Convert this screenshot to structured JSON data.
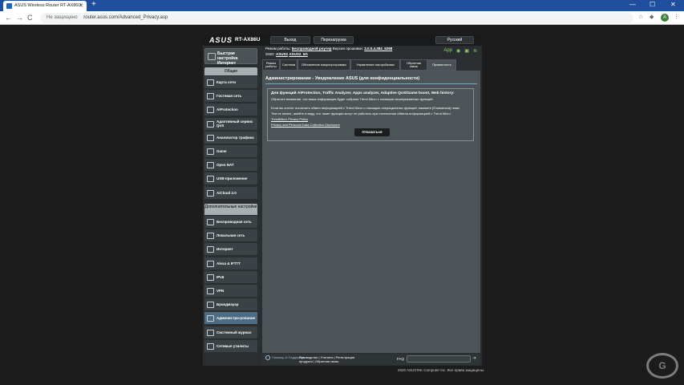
{
  "browser": {
    "tab_title": "ASUS Wireless Router RT-AX86U",
    "tab_close": "✕",
    "new_tab": "+",
    "win_min": "—",
    "win_max": "☐",
    "win_close": "✕",
    "back": "←",
    "forward": "→",
    "reload": "C",
    "security": "Не защищено",
    "url": "router.asus.com/Advanced_Privacy.asp",
    "avatar": "A"
  },
  "router": {
    "logo": "ASUS",
    "model": "RT-AX86U",
    "logout": "Выход",
    "reboot": "Перезагрузка",
    "language": "Русский",
    "status_line1_prefix": "Режим работы:",
    "op_mode": "Беспроводной роутер",
    "fw_prefix": "Версия прошивки:",
    "firmware": "3.0.0.4.384_5298",
    "ssid_prefix": "SSID:",
    "ssid1": "ASUS2",
    "ssid2": "ASUS2_5G",
    "app_label": "App"
  },
  "sidebar": {
    "quick_setup": "Быстрая настройка Интернет",
    "general": "Общие",
    "advanced": "Дополнительные настройки",
    "items_general": [
      {
        "label": "Карта сети",
        "icon": "network-map-icon"
      },
      {
        "label": "Гостевая сеть",
        "icon": "guest-network-icon"
      },
      {
        "label": "AiProtection",
        "icon": "shield-icon"
      },
      {
        "label": "Адаптивный сервис QoS",
        "icon": "qos-icon"
      },
      {
        "label": "Анализатор трафика",
        "icon": "traffic-icon"
      },
      {
        "label": "Game",
        "icon": "gamepad-icon"
      },
      {
        "label": "Open NAT",
        "icon": "nat-icon"
      },
      {
        "label": "USB-приложение",
        "icon": "usb-icon"
      },
      {
        "label": "AiCloud 2.0",
        "icon": "cloud-icon"
      }
    ],
    "items_advanced": [
      {
        "label": "Беспроводная сеть",
        "icon": "wifi-icon"
      },
      {
        "label": "Локальная сеть",
        "icon": "lan-icon"
      },
      {
        "label": "Интернет",
        "icon": "globe-icon"
      },
      {
        "label": "Alexa & IFTTT",
        "icon": "alexa-icon"
      },
      {
        "label": "IPv6",
        "icon": "ipv6-icon"
      },
      {
        "label": "VPN",
        "icon": "vpn-icon"
      },
      {
        "label": "Брандмауэр",
        "icon": "firewall-icon"
      },
      {
        "label": "Администри-рование",
        "icon": "admin-icon"
      },
      {
        "label": "Системный журнал",
        "icon": "log-icon"
      },
      {
        "label": "Сетевые утилиты",
        "icon": "tools-icon"
      }
    ]
  },
  "tabs": [
    "Режим работы",
    "Система",
    "Обновление микропрограммы",
    "Управление настройками",
    "Обратная связь",
    "Приватность"
  ],
  "panel": {
    "title": "Администрирование - Уведомление ASUS (для конфиденциальности)",
    "box_title": "Для функций AiProtection, Traffic Analyzer, Apps analyzer, Adaptive QoS/Game boost, Web history:",
    "box_desc": "Обратите внимание, что ваша информация будет собрана Trend Micro с помощью вышеуказанных функций.",
    "box_p1": "Если вы хотите отключить обмен информацией с Trend Micro с помощью операционных функций, нажмите [Отказаться] ниже.",
    "box_p2": "Тем не менее, имейте в виду, что такие функции могут не работать при отключении обмена информацией с Trend Micro.",
    "link1": "TrendMicro Privacy Policy",
    "link2": "Privacy and Personal Data Collection Disclosure",
    "optout": "Отказаться"
  },
  "footer": {
    "help": "Помощь & Поддержка",
    "links_line1": "Руководство | Утилиты | Регистрация",
    "links_line2": "продукта | Обратная связь",
    "faq": "FAQ",
    "go": "➔",
    "copyright": "2020 ASUSTeK Computer Inc. Все права защищены."
  }
}
